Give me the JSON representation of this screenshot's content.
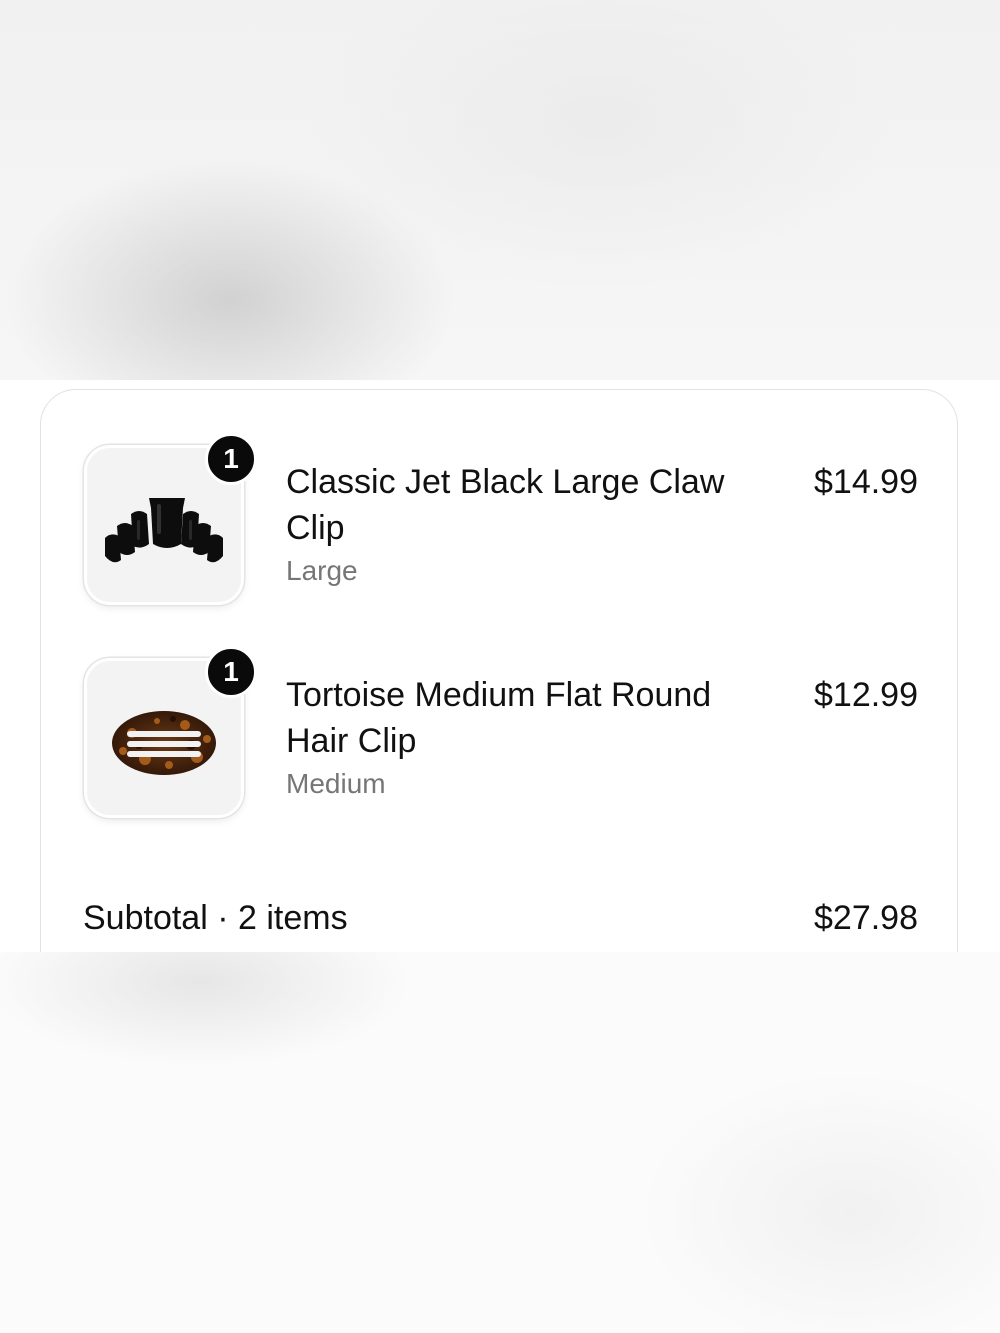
{
  "cart": {
    "items": [
      {
        "quantity": "1",
        "title": "Classic Jet Black Large Claw Clip",
        "variant": "Large",
        "price": "$14.99",
        "image_icon": "black-claw-clip-image"
      },
      {
        "quantity": "1",
        "title": "Tortoise Medium Flat Round Hair Clip",
        "variant": "Medium",
        "price": "$12.99",
        "image_icon": "tortoise-flat-clip-image"
      }
    ],
    "subtotal": {
      "label": "Subtotal · 2 items",
      "value": "$27.98"
    }
  },
  "colors": {
    "badge": "#0a0a0a",
    "text_primary": "#111111",
    "text_secondary": "#767676",
    "card_border": "#e2e2e2"
  }
}
